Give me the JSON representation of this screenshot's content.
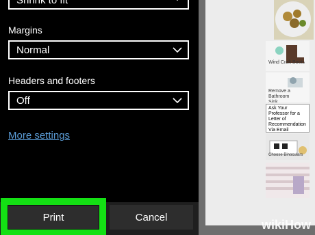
{
  "settings": {
    "scale_value": "Shrink to fit",
    "margins_label": "Margins",
    "margins_value": "Normal",
    "headers_footers_label": "Headers and footers",
    "headers_footers_value": "Off",
    "more_settings_link": "More settings"
  },
  "buttons": {
    "print_label": "Print",
    "cancel_label": "Cancel"
  },
  "preview": {
    "thumb_texts": [
      "Wind Craft Boots",
      "Remove a Bathroom Sink",
      "Ask Your Professor for a Letter of Recommendation Via Email",
      "Choose Binoculars"
    ]
  },
  "watermark": "wikiHow",
  "colors": {
    "highlight": "#14e014",
    "link": "#5a9bd5",
    "button_bg": "#2d2d2d"
  }
}
